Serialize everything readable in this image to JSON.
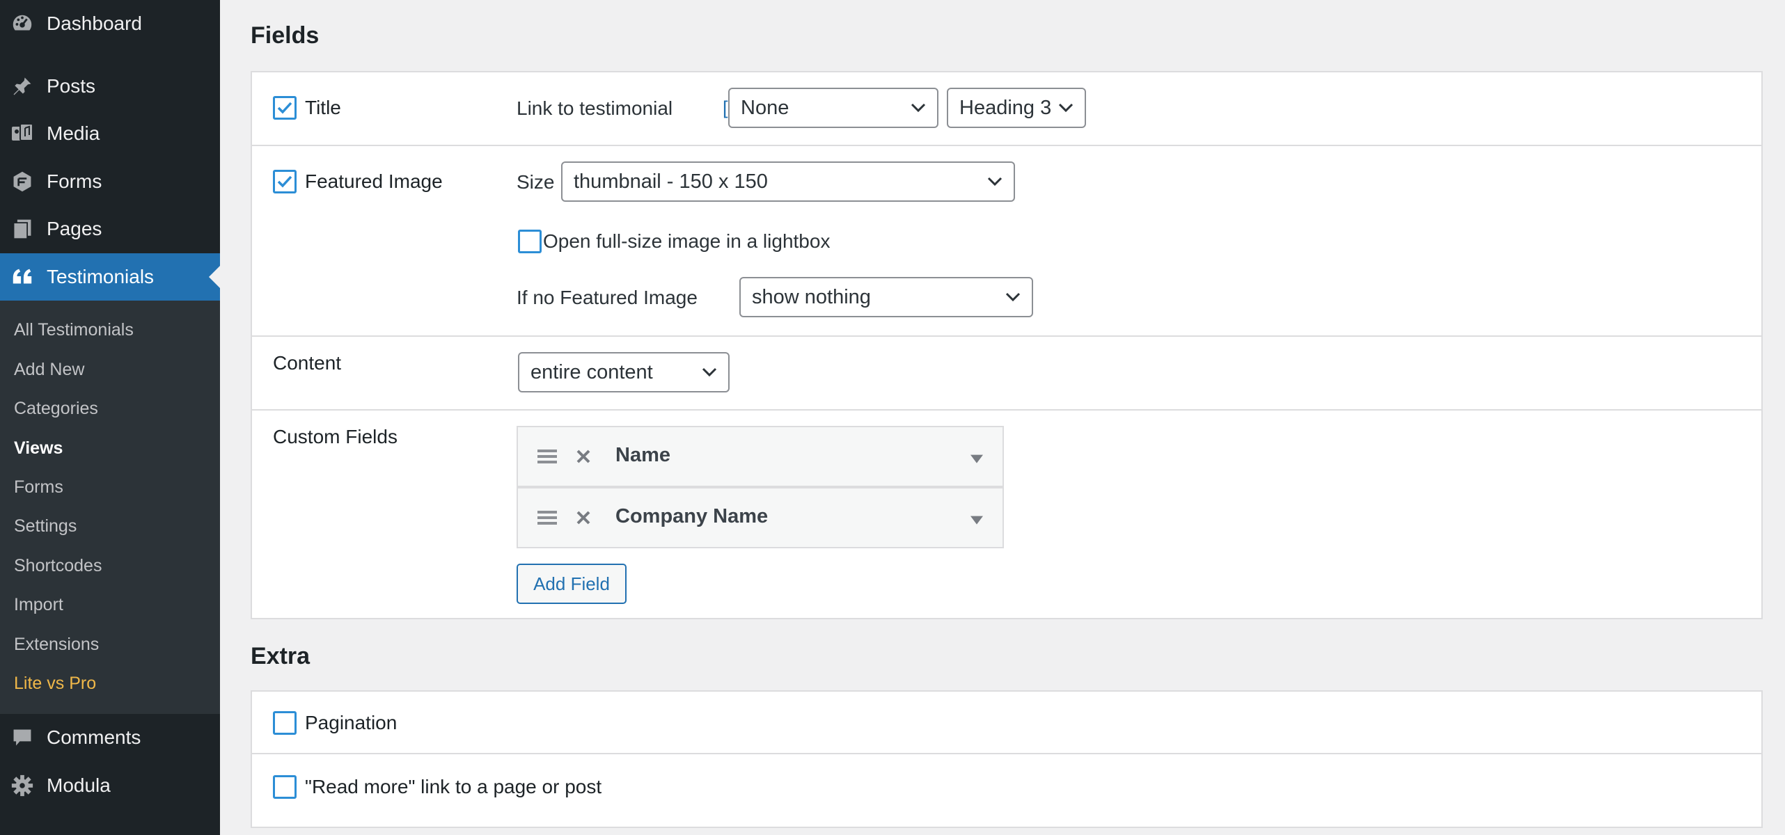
{
  "sidebar": {
    "menu": {
      "dashboard": "Dashboard",
      "posts": "Posts",
      "media": "Media",
      "forms": "Forms",
      "pages": "Pages",
      "testimonials": "Testimonials",
      "comments": "Comments",
      "modula": "Modula"
    },
    "submenu": {
      "all_testimonials": "All Testimonials",
      "add_new": "Add New",
      "categories": "Categories",
      "views": "Views",
      "forms": "Forms",
      "settings": "Settings",
      "shortcodes": "Shortcodes",
      "import": "Import",
      "extensions": "Extensions",
      "lite_vs_pro": "Lite vs Pro"
    },
    "active_submenu": "Views",
    "icons": [
      "dashboard-icon",
      "pin-icon",
      "media-icon",
      "forms-icon",
      "pages-icon",
      "quote-icon",
      "comments-icon",
      "gear-icon"
    ],
    "colors": {
      "background": "#1d2327",
      "submenu": "#2c3338",
      "current": "#2271b1",
      "highlight": "#f0b849"
    }
  },
  "fields": {
    "heading": "Fields",
    "title": {
      "label": "Title",
      "checked": true,
      "link_label": "Link to testimonial",
      "help": "[?]",
      "link_value": "None",
      "heading_value": "Heading 3"
    },
    "featured_image": {
      "label": "Featured Image",
      "checked": true,
      "size_label": "Size",
      "size_value": "thumbnail - 150 x 150",
      "lightbox_label": "Open full-size image in a lightbox",
      "lightbox_checked": false,
      "no_image_label": "If no Featured Image",
      "no_image_value": "show nothing"
    },
    "content": {
      "label": "Content",
      "value": "entire content"
    },
    "custom_fields": {
      "label": "Custom Fields",
      "items": [
        {
          "name": "Name"
        },
        {
          "name": "Company Name"
        }
      ],
      "add_button": "Add Field"
    }
  },
  "extra": {
    "heading": "Extra",
    "pagination": {
      "label": "Pagination",
      "checked": false
    },
    "read_more": {
      "label": "\"Read more\" link to a page or post",
      "checked": false
    }
  },
  "colors": {
    "accent": "#2271b1",
    "checkbox": "#2c8ed6"
  }
}
